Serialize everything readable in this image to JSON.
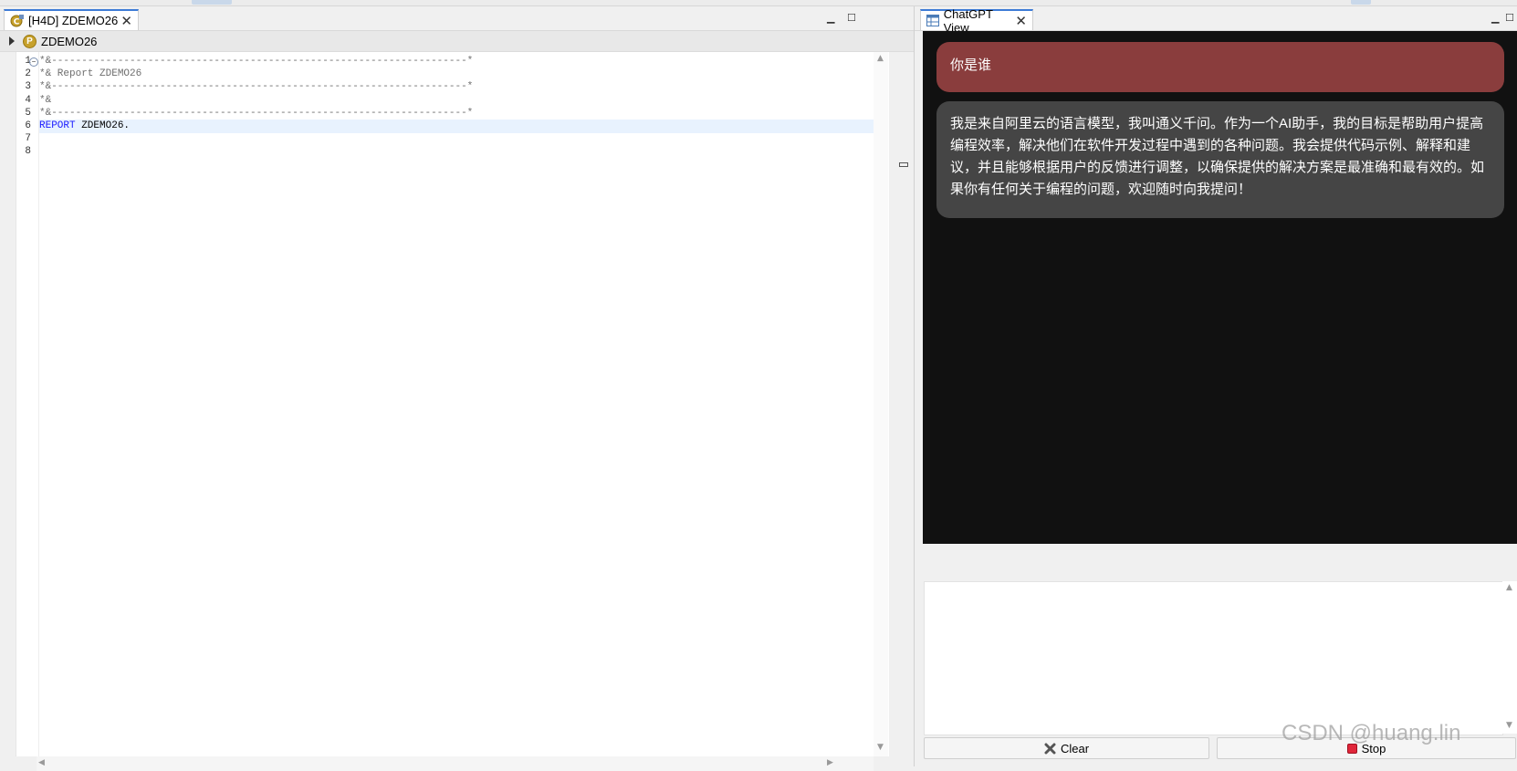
{
  "editor": {
    "tab_label": "[H4D] ZDEMO26",
    "outline_label": "ZDEMO26",
    "outline_badge": "P",
    "lines": [
      {
        "num": "1",
        "text": "*&---------------------------------------------------------------------*",
        "kind": "comment"
      },
      {
        "num": "2",
        "text": "*& Report ZDEMO26",
        "kind": "comment"
      },
      {
        "num": "3",
        "text": "*&---------------------------------------------------------------------*",
        "kind": "comment"
      },
      {
        "num": "4",
        "text": "*&",
        "kind": "comment"
      },
      {
        "num": "5",
        "text": "*&---------------------------------------------------------------------*",
        "kind": "comment"
      },
      {
        "num": "6",
        "keyword": "REPORT",
        "rest": " ZDEMO26.",
        "kind": "code"
      },
      {
        "num": "7",
        "text": "",
        "kind": "empty"
      },
      {
        "num": "8",
        "text": "",
        "kind": "empty"
      }
    ]
  },
  "chat": {
    "tab_label": "ChatGPT View",
    "user_message": "你是谁",
    "ai_message": "我是来自阿里云的语言模型，我叫通义千问。作为一个AI助手，我的目标是帮助用户提高编程效率，解决他们在软件开发过程中遇到的各种问题。我会提供代码示例、解释和建议，并且能够根据用户的反馈进行调整，以确保提供的解决方案是最准确和最有效的。如果你有任何关于编程的问题，欢迎随时向我提问！",
    "input_value": "",
    "clear_label": "Clear",
    "stop_label": "Stop"
  },
  "watermark": "CSDN @huang.lin",
  "colors": {
    "chat_bg": "#111111",
    "user_bubble": "#8a3d3d",
    "ai_bubble": "#454545",
    "keyword": "#1a1aff",
    "tab_accent": "#3d7bd6"
  }
}
